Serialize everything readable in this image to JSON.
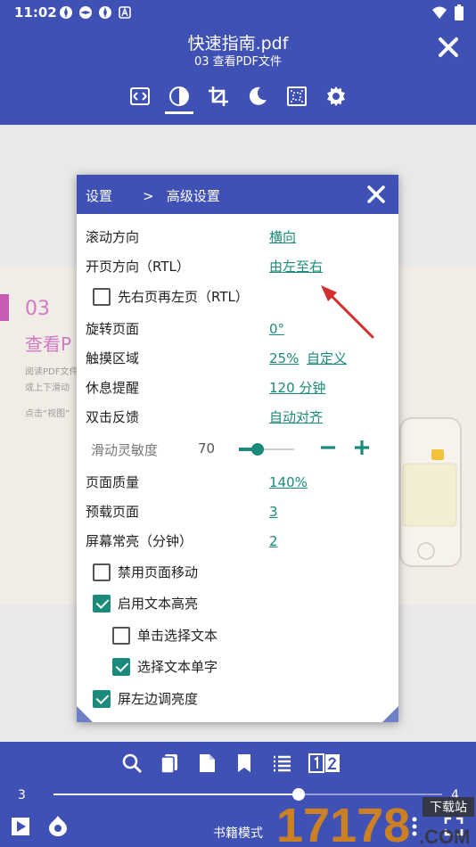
{
  "status": {
    "time": "11:02"
  },
  "header": {
    "title": "快速指南.pdf",
    "subtitle": "03 查看PDF文件"
  },
  "doc": {
    "num": "03",
    "heading": "查看P",
    "line1": "阅读PDF文件",
    "line2": "或上下滑动",
    "line3": "点击“视图”"
  },
  "dialog": {
    "crumb_root": "设置",
    "crumb_sep": ">",
    "crumb_current": "高级设置",
    "scroll_dir": {
      "label": "滚动方向",
      "value": "横向"
    },
    "page_dir": {
      "label": "开页方向（RTL）",
      "value": "由左至右"
    },
    "right_first": {
      "label": "先右页再左页（RTL）",
      "checked": false
    },
    "rotate": {
      "label": "旋转页面",
      "value": "0°"
    },
    "touch": {
      "label": "触摸区域",
      "value": "25%",
      "value2": "自定义"
    },
    "rest": {
      "label": "休息提醒",
      "value": "120 分钟"
    },
    "dbl": {
      "label": "双击反馈",
      "value": "自动对齐"
    },
    "sensitivity": {
      "label": "滑动灵敏度",
      "value": "70",
      "level": 0.25
    },
    "quality": {
      "label": "页面质量",
      "value": "140%"
    },
    "preload": {
      "label": "预载页面",
      "value": "3"
    },
    "screen_on": {
      "label": "屏幕常亮（分钟）",
      "value": "2"
    },
    "disable_move": {
      "label": "禁用页面移动",
      "checked": false
    },
    "text_hl": {
      "label": "启用文本高亮",
      "checked": true
    },
    "single_tap": {
      "label": "单击选择文本",
      "checked": false
    },
    "select_word": {
      "label": "选择文本单字",
      "checked": true
    },
    "left_brightness": {
      "label": "屏左边调亮度",
      "checked": true
    }
  },
  "bottom": {
    "page_start": "3",
    "page_end": "4",
    "progress": 0.63,
    "mode_label": "书籍模式"
  },
  "watermark": {
    "text": "17178",
    "small": "下载站",
    "suffix": ".COM"
  },
  "colors": {
    "primary": "#3f51b5",
    "accent": "#1a8a7a",
    "arrow": "#d32f2f"
  }
}
